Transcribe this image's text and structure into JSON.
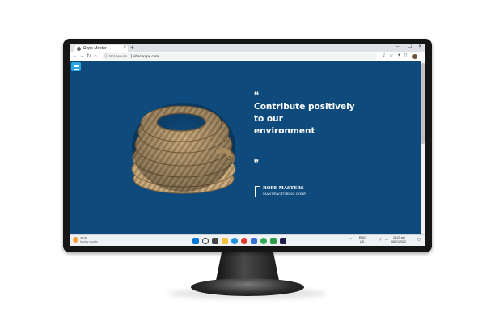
{
  "browser": {
    "tab_title": "Rope Master",
    "tab_close": "×",
    "new_tab": "+",
    "window_controls": {
      "minimize": "–",
      "maximize": "☐",
      "close": "✕"
    },
    "nav": {
      "back": "←",
      "forward": "→",
      "reload": "↻",
      "home": "⌂"
    },
    "security_label": "Not secure",
    "url": "abacarope.com"
  },
  "page": {
    "background_color": "#0e4a7c",
    "menu_button_color": "#2aa7e0",
    "open_quote": "❛❛",
    "headline_lines": [
      "Contribute positively",
      "to our",
      "environment"
    ],
    "close_quote": "❜❜",
    "logo": {
      "line1": "ROPE MASTERS",
      "line2": "MANUFACTURING CORP."
    }
  },
  "taskbar": {
    "weather_temp": "32°F",
    "weather_desc": "Mostly cloudy",
    "tray_lang": "ENG",
    "tray_region": "US",
    "time": "11:23 am",
    "date": "06/21/2022"
  }
}
